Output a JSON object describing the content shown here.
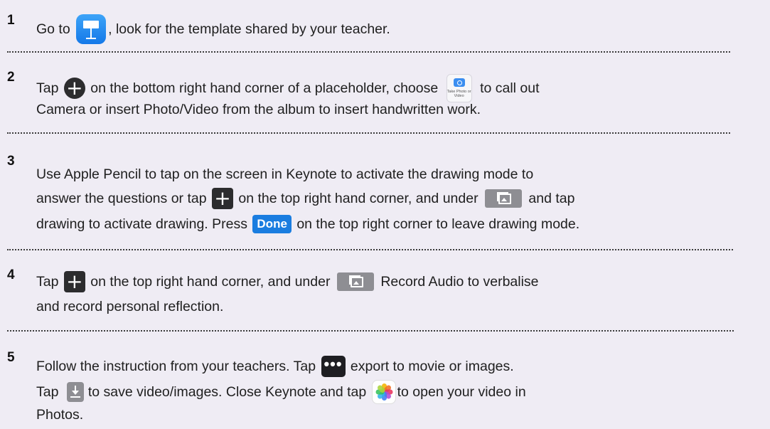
{
  "steps": [
    {
      "number": "1",
      "lines": [
        [
          "Go to",
          ", look for the template shared by your teacher."
        ]
      ]
    },
    {
      "number": "2",
      "lines": [
        [
          "Tap",
          "on the bottom right hand corner of a placeholder, choose",
          "to call out"
        ],
        [
          "Camera or insert Photo/Video from the album to insert handwritten work."
        ]
      ],
      "photo_tile_caption": "Take Photo or Video"
    },
    {
      "number": "3",
      "lines": [
        [
          "Use Apple Pencil to tap on the screen in Keynote to activate the drawing mode to"
        ],
        [
          "answer the questions or tap",
          "on the top right hand corner, and under",
          "and tap"
        ],
        [
          "drawing to activate drawing. Press",
          "on the top right corner to leave drawing mode."
        ]
      ],
      "done_label": "Done"
    },
    {
      "number": "4",
      "lines": [
        [
          "Tap",
          "on the top right hand corner, and under",
          "Record Audio to verbalise"
        ],
        [
          "and record personal reflection."
        ]
      ]
    },
    {
      "number": "5",
      "lines": [
        [
          "Follow the instruction from your teachers. Tap",
          "export to movie or images."
        ],
        [
          "Tap",
          "to save video/images. Close Keynote and tap",
          "to open your video in"
        ],
        [
          "Photos."
        ]
      ],
      "more_label": "•••"
    }
  ],
  "icons": {
    "keynote": "keynote-app-icon",
    "plus_round": "plus-circle-icon",
    "photo_tile": "take-photo-icon",
    "plus_square": "plus-square-icon",
    "media": "media-icon",
    "more": "more-icon",
    "save": "save-icon",
    "photos": "photos-app-icon"
  },
  "colors": {
    "background": "#efecf4",
    "keynote_blue": "#1a7de0",
    "dark_button": "#2c2c2e",
    "grey_button": "#8e8e93"
  }
}
